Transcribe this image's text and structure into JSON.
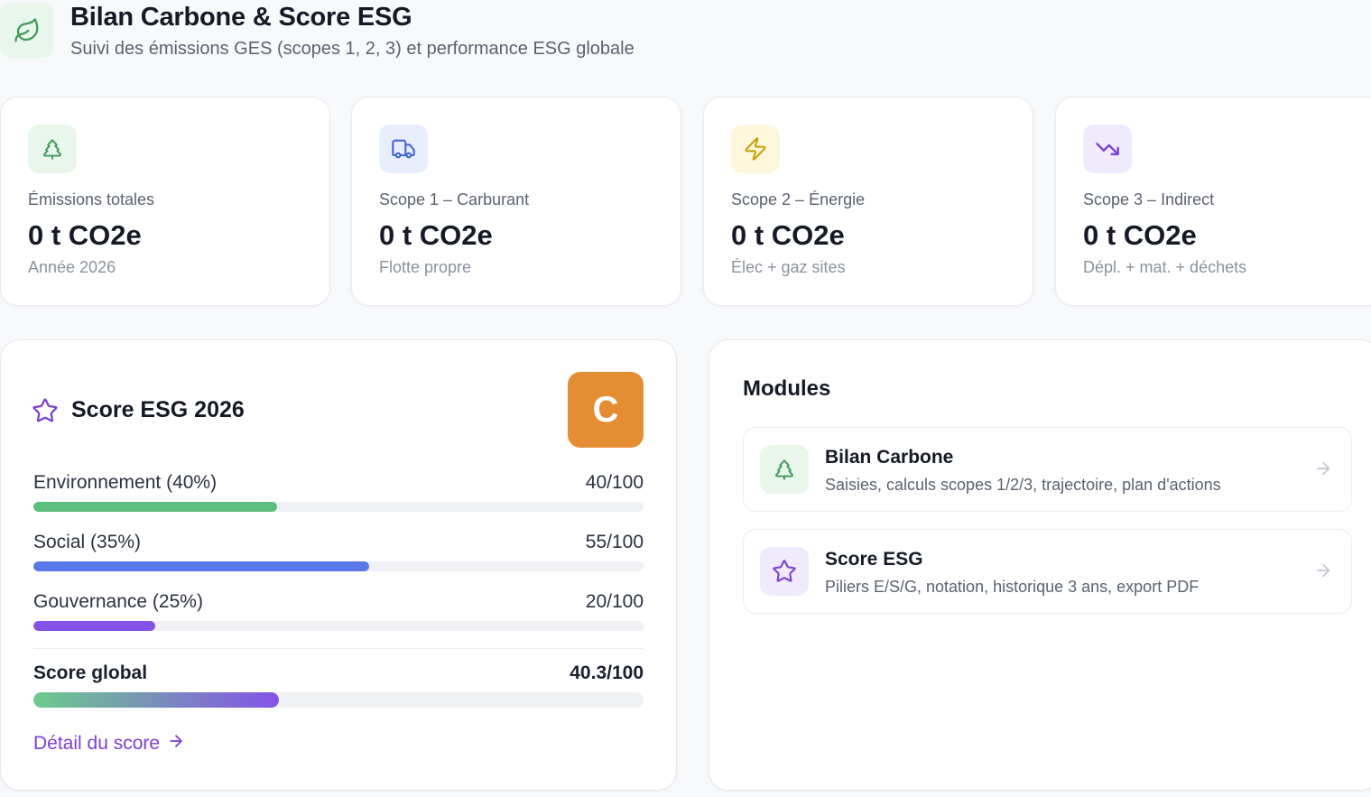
{
  "header": {
    "title": "Bilan Carbone & Score ESG",
    "subtitle": "Suivi des émissions GES (scopes 1, 2, 3) et performance ESG globale",
    "icon": "leaf-icon"
  },
  "kpis": [
    {
      "label": "Émissions totales",
      "value": "0 t CO2e",
      "sub": "Année 2026",
      "icon": "tree-icon",
      "icon_color": "#3f9a5b",
      "icon_bg": "#e9f6ec"
    },
    {
      "label": "Scope 1 – Carburant",
      "value": "0 t CO2e",
      "sub": "Flotte propre",
      "icon": "truck-icon",
      "icon_color": "#3f66d9",
      "icon_bg": "#e8eefc"
    },
    {
      "label": "Scope 2 – Énergie",
      "value": "0 t CO2e",
      "sub": "Élec + gaz sites",
      "icon": "bolt-icon",
      "icon_color": "#c9a008",
      "icon_bg": "#fdf7dc"
    },
    {
      "label": "Scope 3 – Indirect",
      "value": "0 t CO2e",
      "sub": "Dépl. + mat. + déchets",
      "icon": "trending-down-icon",
      "icon_color": "#7b3fd6",
      "icon_bg": "#f0eafd"
    }
  ],
  "score": {
    "title": "Score ESG 2026",
    "grade": "C",
    "grade_color": "#e48d33",
    "pillars": [
      {
        "name": "Environnement (40%)",
        "value": "40/100",
        "percent": 40,
        "color": "#5cbf80"
      },
      {
        "name": "Social (35%)",
        "value": "55/100",
        "percent": 55,
        "color": "#5b78e8"
      },
      {
        "name": "Gouvernance (25%)",
        "value": "20/100",
        "percent": 20,
        "color": "#8552e8"
      }
    ],
    "global": {
      "name": "Score global",
      "value": "40.3/100",
      "percent": 40.3
    },
    "detail_link": "Détail du score"
  },
  "modules": {
    "title": "Modules",
    "items": [
      {
        "title": "Bilan Carbone",
        "desc": "Saisies, calculs scopes 1/2/3, trajectoire, plan d'actions",
        "icon": "tree-icon",
        "icon_color": "#3f9a5b",
        "icon_bg": "#e9f6ec"
      },
      {
        "title": "Score ESG",
        "desc": "Piliers E/S/G, notation, historique 3 ans, export PDF",
        "icon": "star-icon",
        "icon_color": "#7b3fd6",
        "icon_bg": "#f0eafd"
      }
    ]
  }
}
